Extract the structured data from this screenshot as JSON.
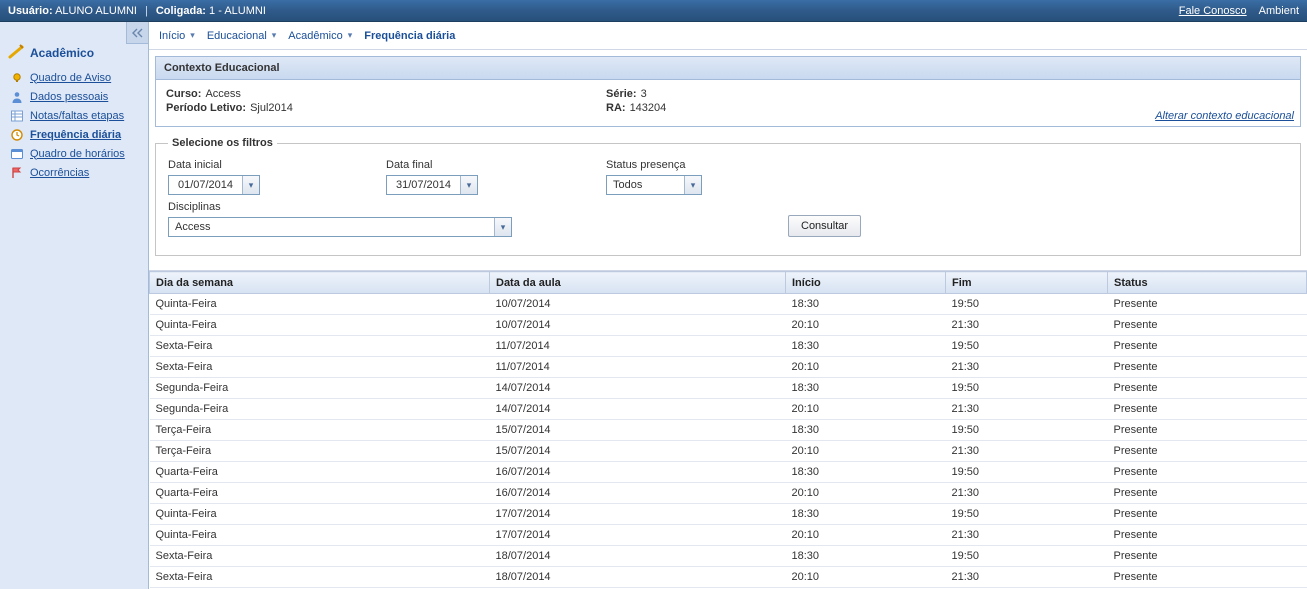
{
  "topbar": {
    "user_label": "Usuário:",
    "user_value": "ALUNO ALUMNI",
    "coligada_label": "Coligada:",
    "coligada_value": "1 - ALUMNI",
    "contact_link": "Fale Conosco",
    "environment": "Ambient"
  },
  "sidebar": {
    "title": "Acadêmico",
    "items": [
      {
        "label": "Quadro de Aviso",
        "icon": "bell-icon"
      },
      {
        "label": "Dados pessoais",
        "icon": "person-icon"
      },
      {
        "label": "Notas/faltas etapas",
        "icon": "grid-icon"
      },
      {
        "label": "Frequência diária",
        "icon": "clock-icon"
      },
      {
        "label": "Quadro de horários",
        "icon": "schedule-icon"
      },
      {
        "label": "Ocorrências",
        "icon": "flag-icon"
      }
    ],
    "active_index": 3
  },
  "breadcrumb": {
    "items": [
      "Início",
      "Educacional",
      "Acadêmico"
    ],
    "current": "Frequência diária"
  },
  "context": {
    "panel_title": "Contexto Educacional",
    "curso_label": "Curso:",
    "curso_value": "Access",
    "periodo_label": "Período Letivo:",
    "periodo_value": "Sjul2014",
    "serie_label": "Série:",
    "serie_value": "3",
    "ra_label": "RA:",
    "ra_value": "143204",
    "alter_link": "Alterar contexto educacional"
  },
  "filters": {
    "legend": "Selecione os filtros",
    "data_inicial_label": "Data inicial",
    "data_inicial_value": "01/07/2014",
    "data_final_label": "Data final",
    "data_final_value": "31/07/2014",
    "status_label": "Status presença",
    "status_value": "Todos",
    "disciplinas_label": "Disciplinas",
    "disciplinas_value": "Access",
    "consult_button": "Consultar"
  },
  "grid": {
    "columns": [
      "Dia da semana",
      "Data da aula",
      "Início",
      "Fim",
      "Status"
    ],
    "rows": [
      [
        "Quinta-Feira",
        "10/07/2014",
        "18:30",
        "19:50",
        "Presente"
      ],
      [
        "Quinta-Feira",
        "10/07/2014",
        "20:10",
        "21:30",
        "Presente"
      ],
      [
        "Sexta-Feira",
        "11/07/2014",
        "18:30",
        "19:50",
        "Presente"
      ],
      [
        "Sexta-Feira",
        "11/07/2014",
        "20:10",
        "21:30",
        "Presente"
      ],
      [
        "Segunda-Feira",
        "14/07/2014",
        "18:30",
        "19:50",
        "Presente"
      ],
      [
        "Segunda-Feira",
        "14/07/2014",
        "20:10",
        "21:30",
        "Presente"
      ],
      [
        "Terça-Feira",
        "15/07/2014",
        "18:30",
        "19:50",
        "Presente"
      ],
      [
        "Terça-Feira",
        "15/07/2014",
        "20:10",
        "21:30",
        "Presente"
      ],
      [
        "Quarta-Feira",
        "16/07/2014",
        "18:30",
        "19:50",
        "Presente"
      ],
      [
        "Quarta-Feira",
        "16/07/2014",
        "20:10",
        "21:30",
        "Presente"
      ],
      [
        "Quinta-Feira",
        "17/07/2014",
        "18:30",
        "19:50",
        "Presente"
      ],
      [
        "Quinta-Feira",
        "17/07/2014",
        "20:10",
        "21:30",
        "Presente"
      ],
      [
        "Sexta-Feira",
        "18/07/2014",
        "18:30",
        "19:50",
        "Presente"
      ],
      [
        "Sexta-Feira",
        "18/07/2014",
        "20:10",
        "21:30",
        "Presente"
      ]
    ]
  }
}
